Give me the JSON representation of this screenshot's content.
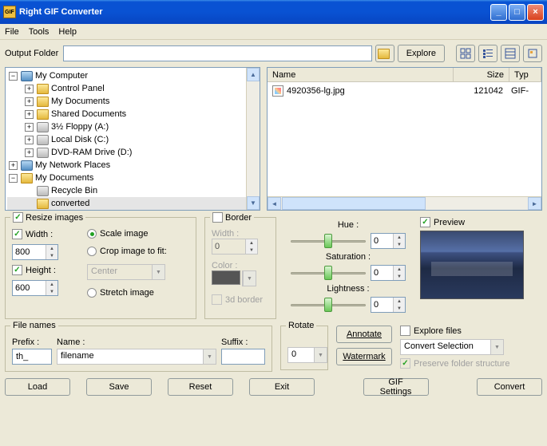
{
  "window": {
    "title": "Right GIF Converter"
  },
  "menu": {
    "file": "File",
    "tools": "Tools",
    "help": "Help"
  },
  "toolbar": {
    "output_label": "Output Folder",
    "output_value": "",
    "explore": "Explore"
  },
  "tree": {
    "computer": "My Computer",
    "control": "Control Panel",
    "mydocs": "My Documents",
    "shared": "Shared Documents",
    "floppy": "3½ Floppy (A:)",
    "localc": "Local Disk (C:)",
    "dvd": "DVD-RAM Drive (D:)",
    "network": "My Network Places",
    "mydocs2": "My Documents",
    "recycle": "Recycle Bin",
    "converted": "converted"
  },
  "list": {
    "col_name": "Name",
    "col_size": "Size",
    "col_type": "Typ",
    "row0_name": "4920356-lg.jpg",
    "row0_size": "121042",
    "row0_type": "GIF-"
  },
  "resize": {
    "title": "Resize images",
    "width_lbl": "Width :",
    "width_val": "800",
    "height_lbl": "Height :",
    "height_val": "600",
    "scale": "Scale image",
    "crop": "Crop image to fit:",
    "center": "Center",
    "stretch": "Stretch image"
  },
  "border": {
    "title": "Border",
    "width_lbl": "Width :",
    "width_val": "0",
    "color_lbl": "Color :",
    "threed": "3d border"
  },
  "adjust": {
    "hue": "Hue :",
    "sat": "Saturation :",
    "light": "Lightness :",
    "val": "0"
  },
  "preview": {
    "title": "Preview"
  },
  "filenames": {
    "title": "File names",
    "prefix_lbl": "Prefix :",
    "prefix_val": "th_",
    "name_lbl": "Name :",
    "name_val": "filename",
    "suffix_lbl": "Suffix :",
    "suffix_val": ""
  },
  "rotate": {
    "title": "Rotate",
    "val": "0"
  },
  "buttons": {
    "annotate": "Annotate",
    "watermark": "Watermark",
    "explore_files": "Explore files",
    "convert_sel": "Convert Selection",
    "preserve": "Preserve folder structure",
    "load": "Load",
    "save": "Save",
    "reset": "Reset",
    "exit": "Exit",
    "gif": "GIF Settings",
    "convert": "Convert"
  }
}
